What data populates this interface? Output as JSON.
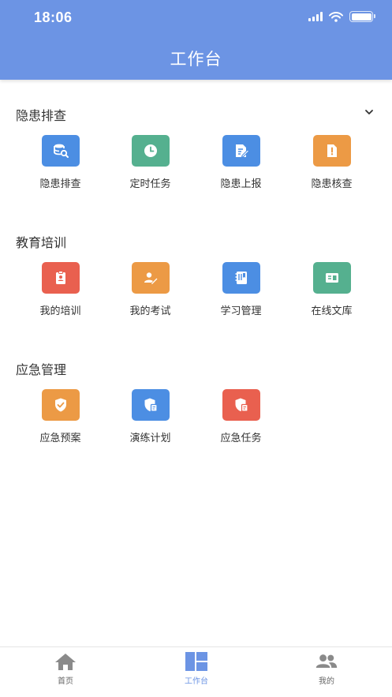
{
  "status_bar": {
    "time": "18:06"
  },
  "nav": {
    "title": "工作台"
  },
  "colors": {
    "header": "#6c94e4",
    "blue": "#4c8ee3",
    "green": "#55b08f",
    "orange": "#ec9a45",
    "red": "#e9604f"
  },
  "sections": [
    {
      "title": "隐患排查",
      "collapse_icon": "chevron-down-icon",
      "items": [
        {
          "label": "隐患排查",
          "icon": "database-search-icon",
          "color": "#4c8ee3"
        },
        {
          "label": "定时任务",
          "icon": "clock-icon",
          "color": "#55b08f"
        },
        {
          "label": "隐患上报",
          "icon": "document-edit-icon",
          "color": "#4c8ee3"
        },
        {
          "label": "隐患核查",
          "icon": "document-alert-icon",
          "color": "#ec9a45"
        }
      ]
    },
    {
      "title": "教育培训",
      "items": [
        {
          "label": "我的培训",
          "icon": "clipboard-user-icon",
          "color": "#e9604f"
        },
        {
          "label": "我的考试",
          "icon": "user-edit-icon",
          "color": "#ec9a45"
        },
        {
          "label": "学习管理",
          "icon": "book-icon",
          "color": "#4c8ee3"
        },
        {
          "label": "在线文库",
          "icon": "library-icon",
          "color": "#55b08f"
        }
      ]
    },
    {
      "title": "应急管理",
      "items": [
        {
          "label": "应急预案",
          "icon": "shield-check-icon",
          "color": "#ec9a45"
        },
        {
          "label": "演练计划",
          "icon": "shield-document-icon",
          "color": "#4c8ee3"
        },
        {
          "label": "应急任务",
          "icon": "shield-document-icon",
          "color": "#e9604f"
        }
      ]
    }
  ],
  "tabbar": {
    "tabs": [
      {
        "label": "首页",
        "icon": "home-icon",
        "active": false
      },
      {
        "label": "工作台",
        "icon": "dashboard-icon",
        "active": true
      },
      {
        "label": "我的",
        "icon": "users-icon",
        "active": false
      }
    ]
  }
}
